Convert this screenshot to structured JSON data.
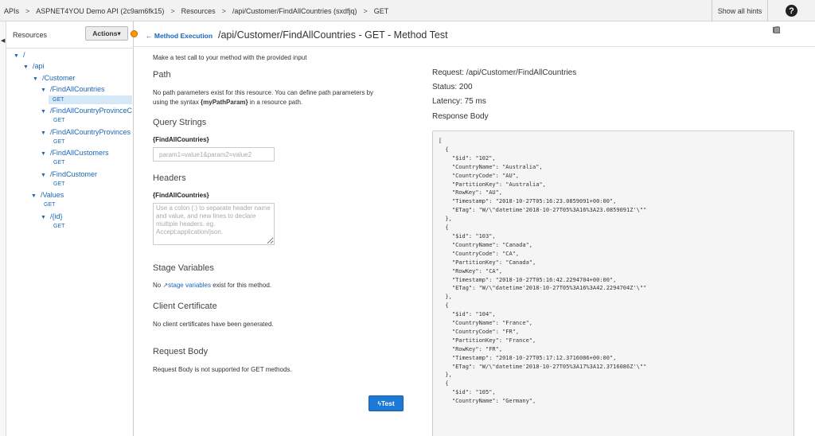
{
  "breadcrumb": [
    "APIs",
    "ASPNET4YOU Demo API (2c9am6fk15)",
    "Resources",
    "/api/Customer/FindAllCountries (sxdfjq)",
    "GET"
  ],
  "header": {
    "show_hints": "Show all hints",
    "help": "?"
  },
  "resources": {
    "title": "Resources",
    "actions_label": "Actions▾",
    "tree": [
      {
        "label": "/"
      },
      {
        "label": "/api"
      },
      {
        "label": "/Customer"
      },
      {
        "label": "/FindAllCountries"
      },
      {
        "label": "GET"
      },
      {
        "label": "/FindAllCountryProvinceC"
      },
      {
        "label": "GET"
      },
      {
        "label": "/FindAllCountryProvinces"
      },
      {
        "label": "GET"
      },
      {
        "label": "/FindAllCustomers"
      },
      {
        "label": "GET"
      },
      {
        "label": "/FindCustomer"
      },
      {
        "label": "GET"
      },
      {
        "label": "/Values"
      },
      {
        "label": "GET"
      },
      {
        "label": "/{id}"
      },
      {
        "label": "GET"
      }
    ]
  },
  "main": {
    "back_link": "Method Execution",
    "title": "/api/Customer/FindAllCountries - GET - Method Test",
    "intro": "Make a test call to your method with the provided input",
    "path": {
      "title": "Path",
      "text_1": "No path parameters exist for this resource. You can define path parameters by",
      "text_2_a": "using the syntax ",
      "text_2_b": "{myPathParam}",
      "text_2_c": " in a resource path."
    },
    "query": {
      "title": "Query Strings",
      "label": "{FindAllCountries}",
      "placeholder": "param1=value1&param2=value2"
    },
    "headers": {
      "title": "Headers",
      "label": "{FindAllCountries}",
      "placeholder": "Use a colon (:) to separate header name and value, and new lines to declare multiple headers. eg. Accept:application/json."
    },
    "stage": {
      "title": "Stage Variables",
      "text_a": "No ",
      "link": "stage variables",
      "text_b": " exist for this method."
    },
    "cert": {
      "title": "Client Certificate",
      "text": "No client certificates have been generated."
    },
    "body": {
      "title": "Request Body",
      "text": "Request Body is not supported for GET methods."
    },
    "test_button": "Test"
  },
  "response": {
    "request": "Request: /api/Customer/FindAllCountries",
    "status": "Status: 200",
    "latency": "Latency: 75 ms",
    "body_title": "Response Body",
    "body": "[\n  {\n    \"$id\": \"102\",\n    \"CountryName\": \"Australia\",\n    \"CountryCode\": \"AU\",\n    \"PartitionKey\": \"Australia\",\n    \"RowKey\": \"AU\",\n    \"Timestamp\": \"2018-10-27T05:16:23.0859091+00:00\",\n    \"ETag\": \"W/\\\"datetime'2018-10-27T05%3A16%3A23.0859091Z'\\\"\"\n  },\n  {\n    \"$id\": \"103\",\n    \"CountryName\": \"Canada\",\n    \"CountryCode\": \"CA\",\n    \"PartitionKey\": \"Canada\",\n    \"RowKey\": \"CA\",\n    \"Timestamp\": \"2018-10-27T05:16:42.2294704+00:00\",\n    \"ETag\": \"W/\\\"datetime'2018-10-27T05%3A16%3A42.2294704Z'\\\"\"\n  },\n  {\n    \"$id\": \"104\",\n    \"CountryName\": \"France\",\n    \"CountryCode\": \"FR\",\n    \"PartitionKey\": \"France\",\n    \"RowKey\": \"FR\",\n    \"Timestamp\": \"2018-10-27T05:17:12.3716086+00:00\",\n    \"ETag\": \"W/\\\"datetime'2018-10-27T05%3A17%3A12.3716086Z'\\\"\"\n  },\n  {\n    \"$id\": \"105\",\n    \"CountryName\": \"Germany\","
  }
}
